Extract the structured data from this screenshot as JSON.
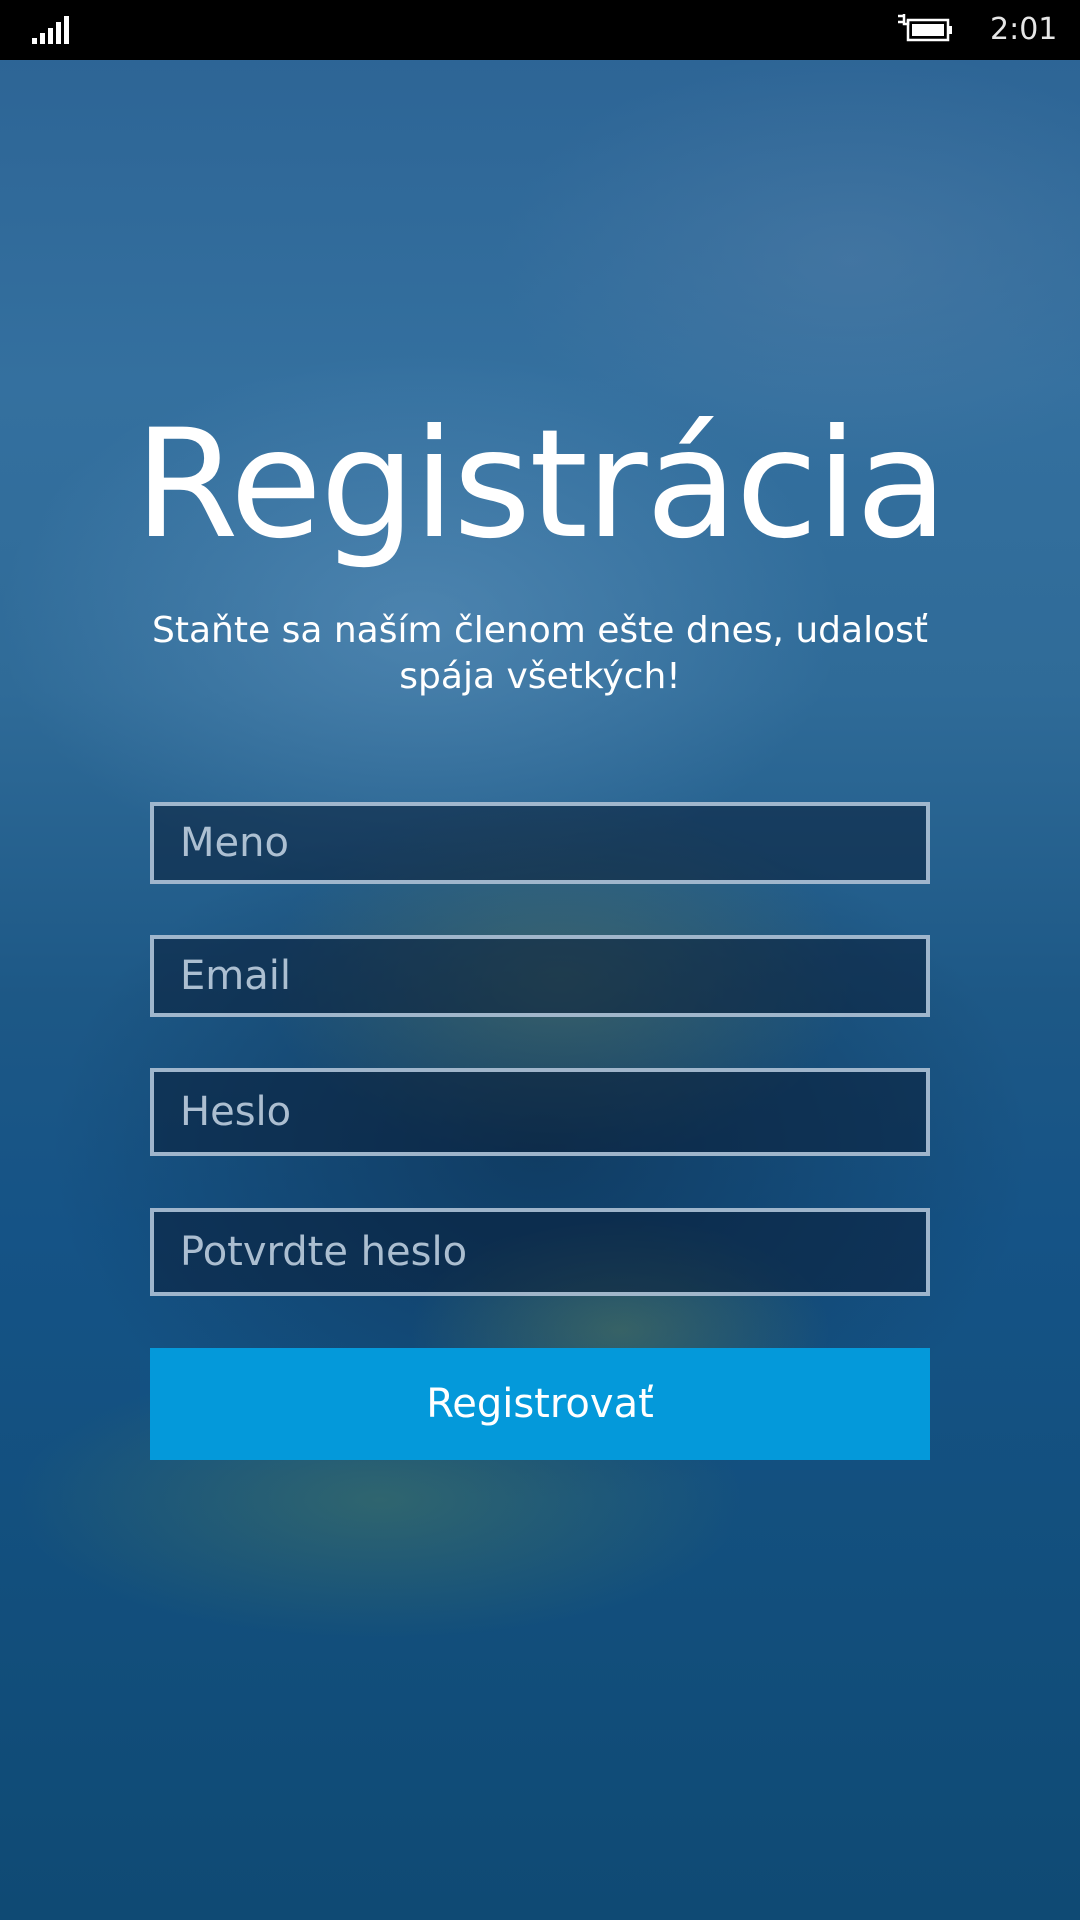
{
  "status_bar": {
    "time": "2:01",
    "signal_icon": "signal-bars-icon",
    "battery_icon": "battery-charging-icon"
  },
  "header": {
    "title": "Registrácia",
    "subtitle": "Staňte sa naším členom ešte dnes, udalosť spája všetkých!"
  },
  "form": {
    "name_placeholder": "Meno",
    "email_placeholder": "Email",
    "password_placeholder": "Heslo",
    "confirm_password_placeholder": "Potvrdte heslo",
    "submit_label": "Registrovať"
  },
  "colors": {
    "accent": "#0499da",
    "status_bar": "#000000",
    "text": "#ffffff"
  }
}
